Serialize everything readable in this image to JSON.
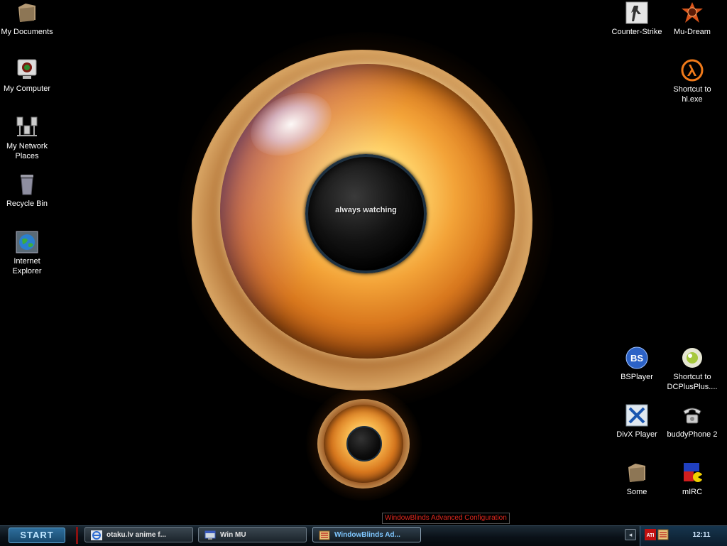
{
  "desktop": {
    "wallpaper_text": "always watching",
    "icons_left": [
      {
        "label": "My Documents",
        "icon": "folder-icon"
      },
      {
        "label": "My Computer",
        "icon": "computer-icon"
      },
      {
        "label": "My Network Places",
        "icon": "network-icon"
      },
      {
        "label": "Recycle Bin",
        "icon": "recycle-bin-icon"
      },
      {
        "label": "Internet Explorer",
        "icon": "globe-icon"
      }
    ],
    "icons_right": [
      {
        "label": "Counter-Strike",
        "icon": "counter-strike-icon"
      },
      {
        "label": "Mu-Dream",
        "icon": "mu-dream-icon"
      },
      {
        "label": "Shortcut to hl.exe",
        "icon": "half-life-icon"
      },
      {
        "label": "BSPlayer",
        "icon": "bsplayer-icon"
      },
      {
        "label": "Shortcut to DCPlusPlus....",
        "icon": "dcplusplus-icon"
      },
      {
        "label": "DivX Player",
        "icon": "divx-icon"
      },
      {
        "label": "buddyPhone 2",
        "icon": "phone-icon"
      },
      {
        "label": "Some",
        "icon": "folder-icon"
      },
      {
        "label": "mIRC",
        "icon": "mirc-icon"
      }
    ]
  },
  "tooltip": "WindowBlinds Advanced Configuration",
  "taskbar": {
    "start_label": "START",
    "tasks": [
      {
        "label": "otaku.lv anime f...",
        "icon": "ie-icon",
        "active": false
      },
      {
        "label": "Win MU",
        "icon": "window-icon",
        "active": false
      },
      {
        "label": "WindowBlinds Ad...",
        "icon": "windowblinds-icon",
        "active": true
      }
    ],
    "clock": "12:11",
    "tray_icons": [
      "ati-icon",
      "windowblinds-tray-icon"
    ]
  }
}
